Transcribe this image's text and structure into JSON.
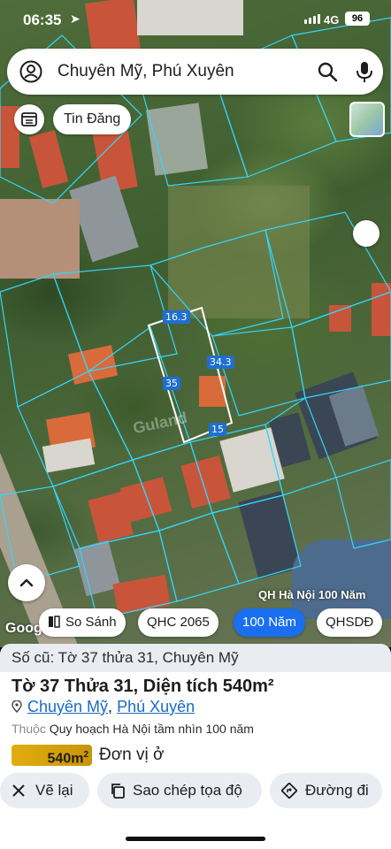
{
  "status_bar": {
    "time": "06:35",
    "network": "4G",
    "battery": "96"
  },
  "search": {
    "query": "Chuyên Mỹ, Phú Xuyên"
  },
  "top_chips": {
    "news_label": "Tin Đăng"
  },
  "map": {
    "dimension_labels": [
      "16.3",
      "34.3",
      "35",
      "15"
    ],
    "watermark": "Guland",
    "planning_label": "QH Hà Nội 100 Năm",
    "google_label": "Google"
  },
  "mode_pills": [
    {
      "label": "So Sánh",
      "active": false
    },
    {
      "label": "QHC 2065",
      "active": false
    },
    {
      "label": "100 Năm",
      "active": true
    },
    {
      "label": "QHSDĐ",
      "active": false
    }
  ],
  "sheet": {
    "old_info": "Số cũ: Tờ 37 thửa 31, Chuyên Mỹ",
    "title": "Tờ 37 Thửa 31, Diện tích 540m²",
    "commune": "Chuyên Mỹ",
    "separator": ", ",
    "district": "Phú Xuyên",
    "plan_key": "Thuộc",
    "plan_value": "Quy hoạch Hà Nội tầm nhìn 100 năm",
    "area_value": "540m",
    "area_unit": "2",
    "land_use": "Đơn vị ở"
  },
  "actions": {
    "redraw": "Vẽ lại",
    "copy": "Sao chép tọa độ",
    "directions": "Đường đi"
  },
  "colors": {
    "accent": "#1a6ff0",
    "parcel_outline": "#33d6ff",
    "highlight_parcel": "#ffffff",
    "area_badge": "#e0ad10",
    "link": "#1a6ac9"
  }
}
